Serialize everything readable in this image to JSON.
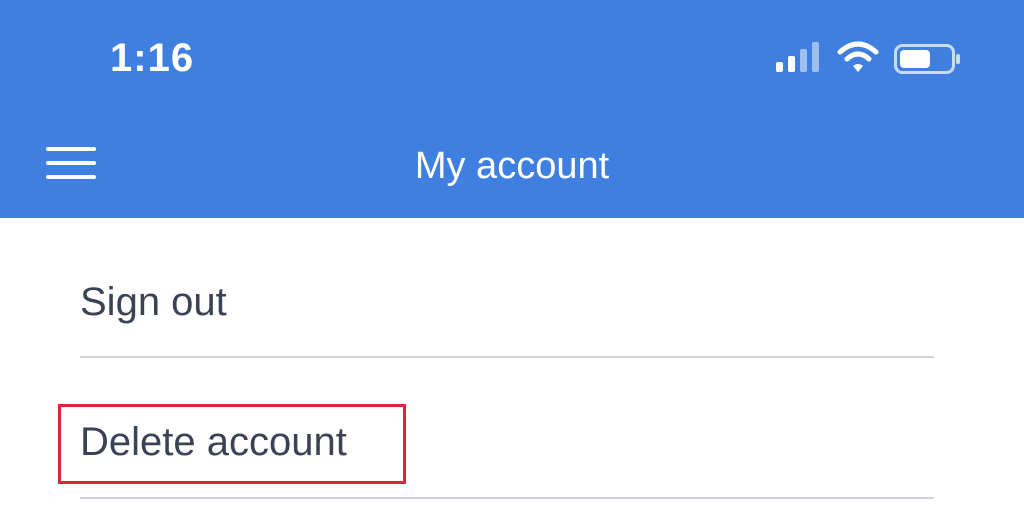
{
  "status_bar": {
    "time": "1:16",
    "icons": [
      "signal-icon",
      "wifi-icon",
      "battery-icon"
    ]
  },
  "header": {
    "title": "My account",
    "menu_icon": "hamburger-menu-icon",
    "background_color": "#3f7fe0"
  },
  "menu": {
    "items": [
      {
        "label": "Sign out"
      },
      {
        "label": "Delete account"
      }
    ]
  },
  "annotation": {
    "highlight_color": "#e0243a"
  }
}
